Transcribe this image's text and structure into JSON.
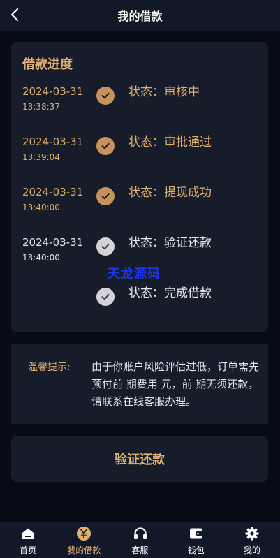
{
  "header": {
    "title": "我的借款",
    "back_icon": "chevron-left-icon"
  },
  "progress": {
    "title": "借款进度",
    "steps": [
      {
        "date": "2024-03-31",
        "time": "13:38:37",
        "status": "状态：审核中",
        "done": true
      },
      {
        "date": "2024-03-31",
        "time": "13:39:04",
        "status": "状态：审批通过",
        "done": true
      },
      {
        "date": "2024-03-31",
        "time": "13:40:00",
        "status": "状态：提现成功",
        "done": true
      },
      {
        "date": "2024-03-31",
        "time": "13:40:00",
        "status": "状态：验证还款",
        "done": false
      },
      {
        "date": "",
        "time": "",
        "status": "状态：完成借款",
        "done": false
      }
    ],
    "watermark": "天龙源码"
  },
  "notice": {
    "label": "温馨提示:",
    "text": "由于你账户风险评估过低，订单需先预付前 期费用 元，前 期无须还款，请联系在线客服办理。"
  },
  "action_button": {
    "label": "验证还款"
  },
  "tabbar": {
    "items": [
      {
        "label": "首页",
        "icon": "home-icon"
      },
      {
        "label": "我的借款",
        "icon": "yen-icon",
        "active": true
      },
      {
        "label": "客服",
        "icon": "headset-icon"
      },
      {
        "label": "钱包",
        "icon": "wallet-icon"
      },
      {
        "label": "我的",
        "icon": "gear-icon"
      }
    ]
  },
  "colors": {
    "accent": "#e0b071",
    "done_dot": "#c8935a",
    "pending_dot": "#d4d4d8",
    "background": "#070b16",
    "card": "#161c2a",
    "watermark": "#1d36f0"
  }
}
